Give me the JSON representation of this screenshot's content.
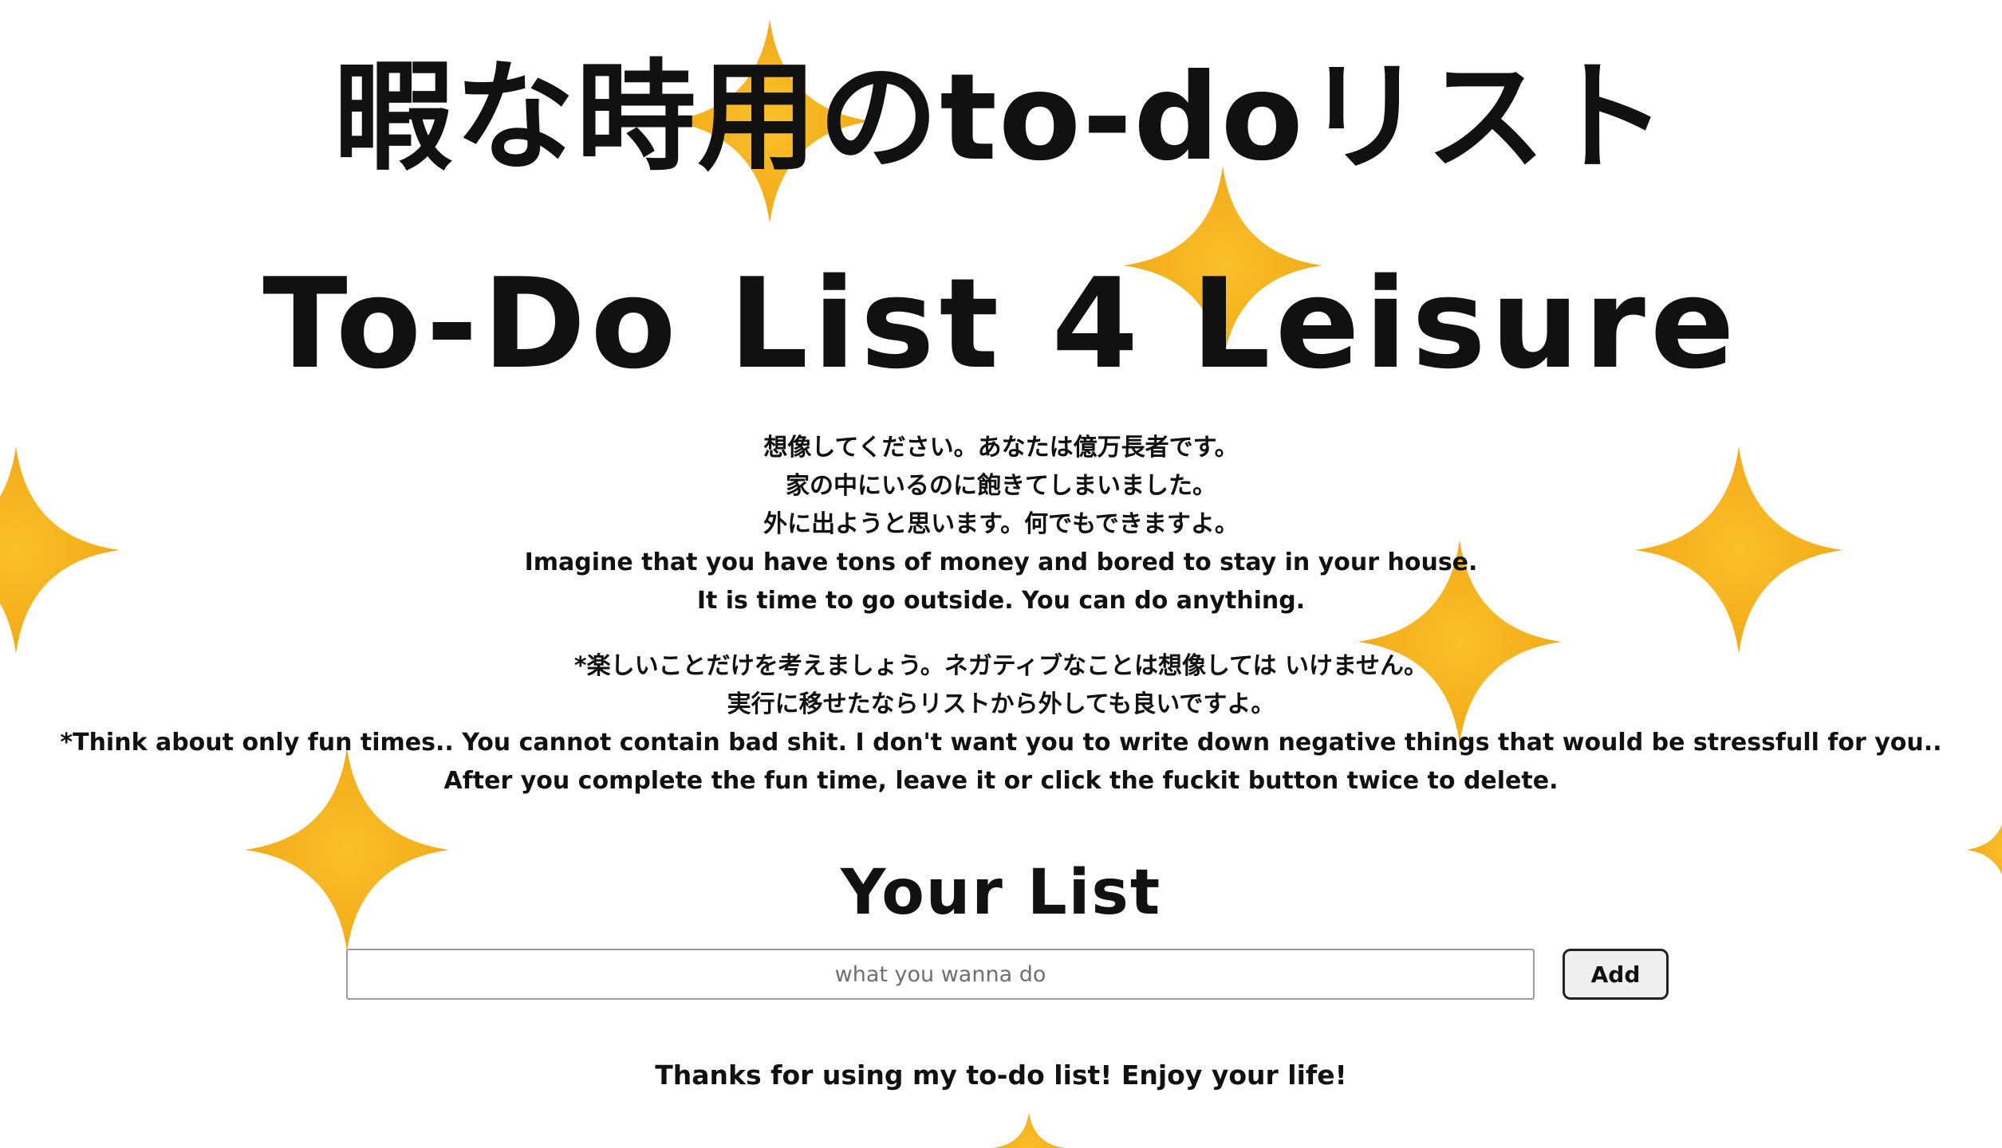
{
  "header": {
    "title_jp": "暇な時用のto-doリスト",
    "title_en": "To-Do List 4 Leisure"
  },
  "intro": {
    "lines": [
      "想像してください。あなたは億万長者です。",
      "家の中にいるのに飽きてしまいました。",
      "外に出ようと思います。何でもできますよ。",
      "Imagine that you have tons of money and bored to stay in your house.",
      "It is time to go outside. You can do anything."
    ]
  },
  "notes": {
    "lines": [
      "*楽しいことだけを考えましょう。ネガティブなことは想像しては いけません。",
      "実行に移せたならリストから外しても良いですよ。",
      "*Think about only fun times.. You cannot contain bad shit. I don't want you to write down negative things that would be stressfull for you..",
      "After you complete the fun time, leave it or click the fuckit button twice to delete."
    ]
  },
  "list": {
    "heading": "Your List",
    "input_value": "",
    "input_placeholder": "what you wanna do",
    "add_label": "Add"
  },
  "footer": {
    "thanks": "Thanks for using my to-do list! Enjoy your life!"
  },
  "colors": {
    "sparkle": "#f6b21a",
    "text": "#111111",
    "background": "#ffffff"
  },
  "icons": {
    "decoration": "sparkle-star-icon"
  }
}
